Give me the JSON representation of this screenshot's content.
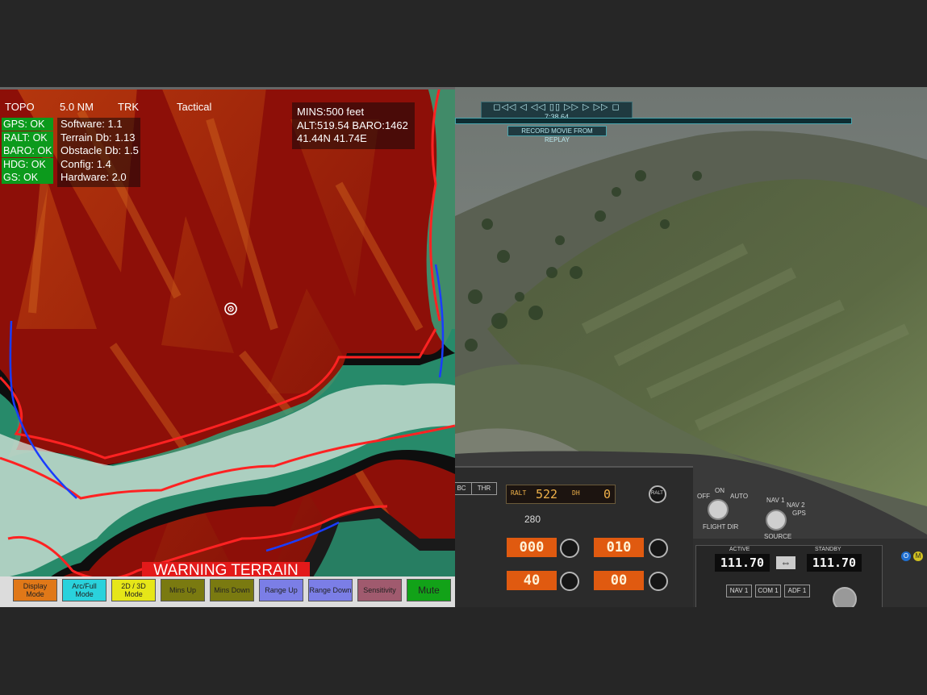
{
  "map": {
    "mode": "TOPO",
    "range": "5.0 NM",
    "orientation": "TRK",
    "view": "Tactical",
    "status": [
      "GPS: OK",
      "RALT: OK",
      "BARO: OK",
      "HDG: OK",
      "GS: OK"
    ],
    "versions": [
      "Software: 1.1",
      "Terrain Db: 1.13",
      "Obstacle Db: 1.5",
      "Config: 1.4",
      "Hardware: 2.0"
    ],
    "mins": "MINS:500 feet",
    "alt_baro": "ALT:519.54 BARO:1462",
    "position": "41.44N 41.74E",
    "warning": "WARNING TERRAIN"
  },
  "buttons": [
    {
      "label": "Display Mode",
      "color": "#e07818"
    },
    {
      "label": "Arc/Full Mode",
      "color": "#2ad2dc"
    },
    {
      "label": "2D / 3D Mode",
      "color": "#e6e618"
    },
    {
      "label": "Mins Up",
      "color": "#7a7a10"
    },
    {
      "label": "Mins Down",
      "color": "#7a7a10"
    },
    {
      "label": "Range Up",
      "color": "#7b7ee6"
    },
    {
      "label": "Range Down",
      "color": "#7b7ee6"
    },
    {
      "label": "Sensitivity",
      "color": "#a05a6e"
    },
    {
      "label": "Mute",
      "color": "#12a218"
    }
  ],
  "sim": {
    "replay_controls": "◻◁◁ ◁ ◁◁ ▯▯ ▷▷ ▷ ▷▷ ◻",
    "replay_time": "7:38.64",
    "record_label": "RECORD MOVIE FROM REPLAY",
    "ralt_label": "RALT",
    "ralt_value": "522",
    "dh_label": "DH",
    "dh_value": "0",
    "heading": "280",
    "ralt_button": "RALT",
    "tabs": [
      "BC",
      "THR"
    ],
    "displays": [
      "000",
      "010",
      "40",
      "00"
    ],
    "flight_dir": {
      "off": "OFF",
      "on": "ON",
      "auto": "AUTO",
      "label": "FLIGHT DIR"
    },
    "source": {
      "nav1": "NAV 1",
      "nav2": "NAV 2",
      "gps": "GPS",
      "label": "SOURCE"
    },
    "active_label": "ACTIVE",
    "standby_label": "STANDBY",
    "active_freq": "111.70",
    "standby_freq": "111.70",
    "swap_icon": "⇔",
    "nav_buttons": [
      "NAV 1",
      "COM 1",
      "ADF 1"
    ],
    "markers": [
      "O",
      "M"
    ]
  }
}
